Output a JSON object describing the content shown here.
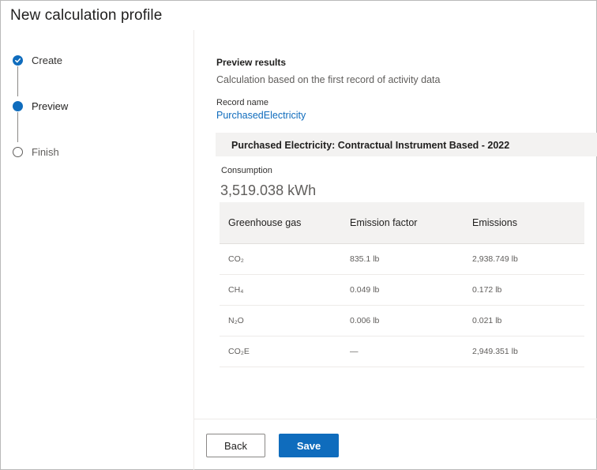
{
  "page": {
    "title": "New calculation profile"
  },
  "stepper": {
    "steps": [
      {
        "label": "Create",
        "state": "completed",
        "icon": "checkmark-icon"
      },
      {
        "label": "Preview",
        "state": "current",
        "icon": "current-step-dot-icon"
      },
      {
        "label": "Finish",
        "state": "pending",
        "icon": "empty-circle-icon"
      }
    ]
  },
  "preview": {
    "title": "Preview results",
    "subtitle": "Calculation based on the first record of activity data",
    "record_label": "Record name",
    "record_name": "PurchasedElectricity",
    "group_title": "Purchased Electricity: Contractual Instrument Based - 2022",
    "consumption_label": "Consumption",
    "consumption_value": "3,519.038 kWh"
  },
  "table": {
    "headers": [
      "Greenhouse gas",
      "Emission factor",
      "Emissions"
    ],
    "rows": [
      {
        "gas": "CO₂",
        "factor": "835.1 lb",
        "emissions": "2,938.749 lb"
      },
      {
        "gas": "CH₄",
        "factor": "0.049 lb",
        "emissions": "0.172 lb"
      },
      {
        "gas": "N₂O",
        "factor": "0.006 lb",
        "emissions": "0.021 lb"
      },
      {
        "gas": "CO₂E",
        "factor": "—",
        "emissions": "2,949.351 lb"
      }
    ]
  },
  "footer": {
    "back_label": "Back",
    "save_label": "Save"
  },
  "colors": {
    "accent": "#0f6cbd",
    "header_bg": "#f3f2f1",
    "border": "#edebe9"
  }
}
